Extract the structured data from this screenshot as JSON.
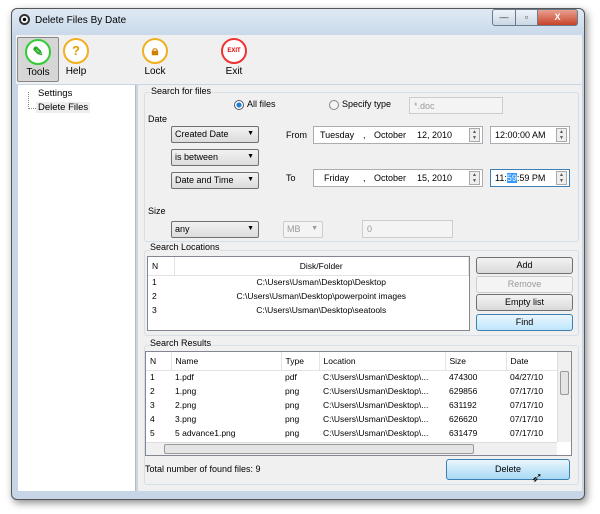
{
  "window": {
    "title": "Delete Files By Date",
    "minimize": "—",
    "maximize": "▫",
    "close": "X"
  },
  "toolbar": {
    "tools": "Tools",
    "help": "Help",
    "lock": "Lock",
    "exit": "Exit",
    "exit_icon_text": "EXIT"
  },
  "tree": {
    "items": [
      "Settings",
      "Delete Files"
    ]
  },
  "search": {
    "group_label": "Search for files",
    "all_files": "All files",
    "specify_type": "Specify type",
    "type_value": "*.doc"
  },
  "date": {
    "label": "Date",
    "field": "Created Date",
    "condition": "is between",
    "mode": "Date and Time",
    "from_label": "From",
    "from_day": "Tuesday",
    "from_month": "October",
    "from_date": "12, 2010",
    "from_time": "12:00:00 AM",
    "to_label": "To",
    "to_day": "Friday",
    "to_month": "October",
    "to_date": "15, 2010",
    "to_time_h": "11:",
    "to_time_m": "59",
    "to_time_rest": ":59 PM",
    "sep": ","
  },
  "size": {
    "label": "Size",
    "comparison": "any",
    "unit": "MB",
    "value": "0"
  },
  "locations": {
    "label": "Search Locations",
    "headers": [
      "N",
      "Disk/Folder"
    ],
    "rows": [
      [
        "1",
        "C:\\Users\\Usman\\Desktop\\Desktop"
      ],
      [
        "2",
        "C:\\Users\\Usman\\Desktop\\powerpoint images"
      ],
      [
        "3",
        "C:\\Users\\Usman\\Desktop\\seatools"
      ]
    ],
    "buttons": {
      "add": "Add",
      "remove": "Remove",
      "empty": "Empty list",
      "find": "Find"
    }
  },
  "results": {
    "label": "Search Results",
    "headers": [
      "N",
      "Name",
      "Type",
      "Location",
      "Size",
      "Date"
    ],
    "rows": [
      [
        "1",
        "1.pdf",
        "pdf",
        "C:\\Users\\Usman\\Desktop\\...",
        "474300",
        "04/27/10"
      ],
      [
        "2",
        "1.png",
        "png",
        "C:\\Users\\Usman\\Desktop\\...",
        "629856",
        "07/17/10"
      ],
      [
        "3",
        "2.png",
        "png",
        "C:\\Users\\Usman\\Desktop\\...",
        "631192",
        "07/17/10"
      ],
      [
        "4",
        "3.png",
        "png",
        "C:\\Users\\Usman\\Desktop\\...",
        "626620",
        "07/17/10"
      ],
      [
        "5",
        "5 advance1.png",
        "png",
        "C:\\Users\\Usman\\Desktop\\...",
        "631479",
        "07/17/10"
      ]
    ],
    "total": "Total number of found files: 9",
    "delete": "Delete"
  }
}
